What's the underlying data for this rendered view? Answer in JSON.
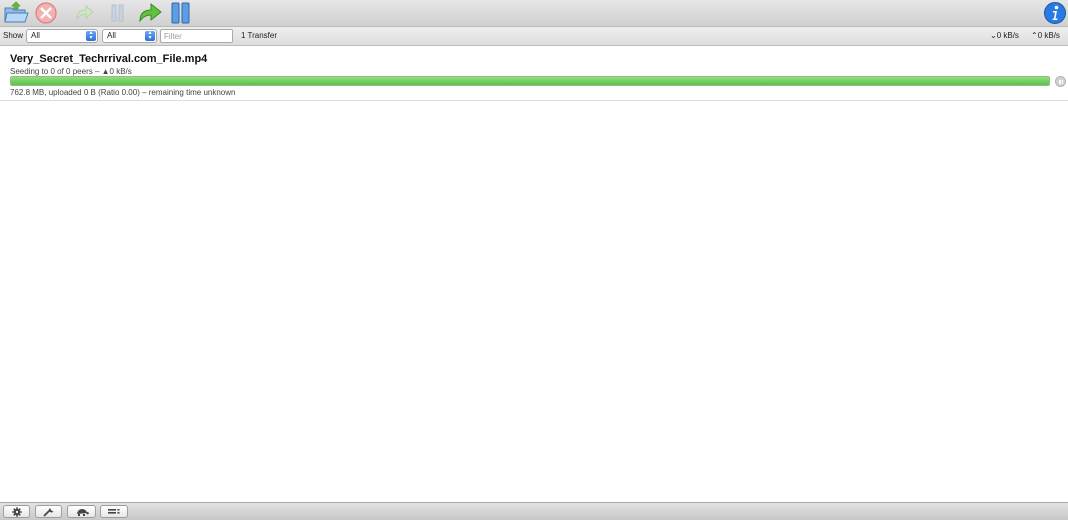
{
  "toolbar": {
    "buttons": [
      {
        "name": "open-torrent",
        "icon": "folder-open-icon"
      },
      {
        "name": "remove",
        "icon": "remove-icon"
      },
      {
        "name": "resume",
        "icon": "resume-arrow-icon"
      },
      {
        "name": "pause",
        "icon": "pause-bars-icon"
      },
      {
        "name": "resume-all",
        "icon": "resume-all-arrow-icon"
      },
      {
        "name": "pause-all",
        "icon": "pause-all-icon"
      }
    ],
    "info_icon": "info-icon"
  },
  "filter_bar": {
    "show_label": "Show",
    "filter_select_1": "All",
    "filter_select_2": "All",
    "filter_placeholder": "Filter",
    "filter_value": "",
    "transfer_count": "1 Transfer",
    "download_rate": "0 kB/s",
    "upload_rate": "0 kB/s"
  },
  "torrents": [
    {
      "name": "Very_Secret_Techrrival.com_File.mp4",
      "status": "Seeding to 0 of 0 peers – ▲0 kB/s",
      "progress": 1.0,
      "details": "762.8 MB, uploaded 0 B (Ratio 0.00) – remaining time unknown"
    }
  ],
  "bottom_bar": {
    "buttons": [
      "gear-icon",
      "wrench-icon",
      "turtle-icon",
      "list-icon"
    ]
  },
  "colors": {
    "progress_fill": "#58c446",
    "select_arrows": "#2d6fd8",
    "info_blue": "#1f6fd1"
  }
}
